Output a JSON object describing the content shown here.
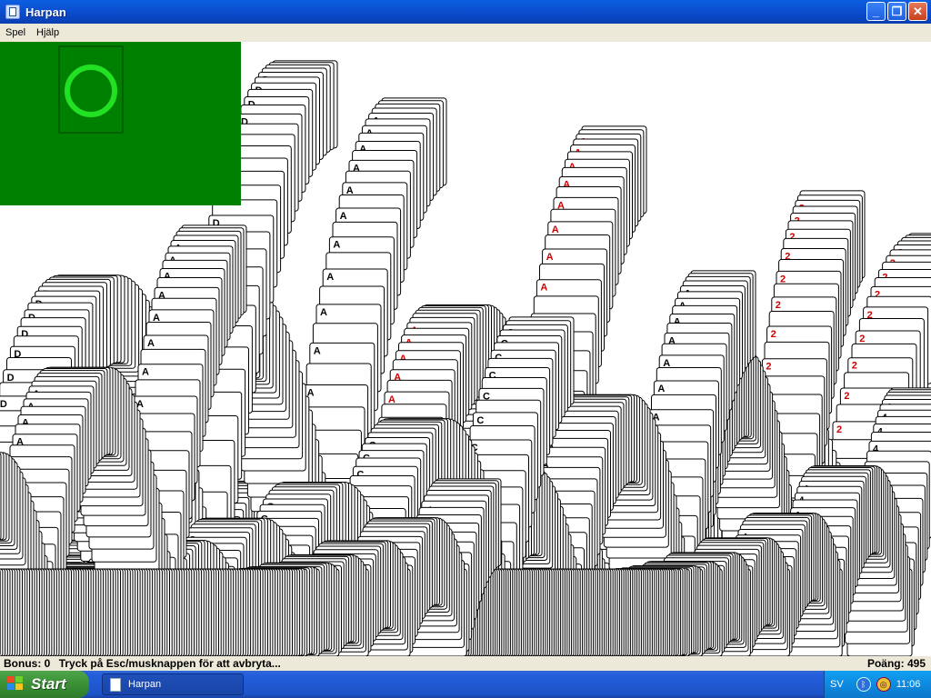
{
  "window": {
    "title": "Harpan"
  },
  "menu": {
    "items": [
      "Spel",
      "Hjälp"
    ]
  },
  "status": {
    "bonus": "Bonus: 0",
    "message": "Tryck på Esc/musknappen för att avbryta...",
    "score": "Poäng: 495"
  },
  "taskbar": {
    "start_label": "Start",
    "task_label": "Harpan",
    "language": "SV",
    "clock": "11:06"
  },
  "colors": {
    "felt": "#008000",
    "red": "#d00000",
    "stock_ring": "#22e022"
  },
  "icons": [
    "app-icon",
    "minimize-icon",
    "maximize-icon",
    "close-icon",
    "windows-flag-icon",
    "bluetooth-icon",
    "globe-icon"
  ]
}
